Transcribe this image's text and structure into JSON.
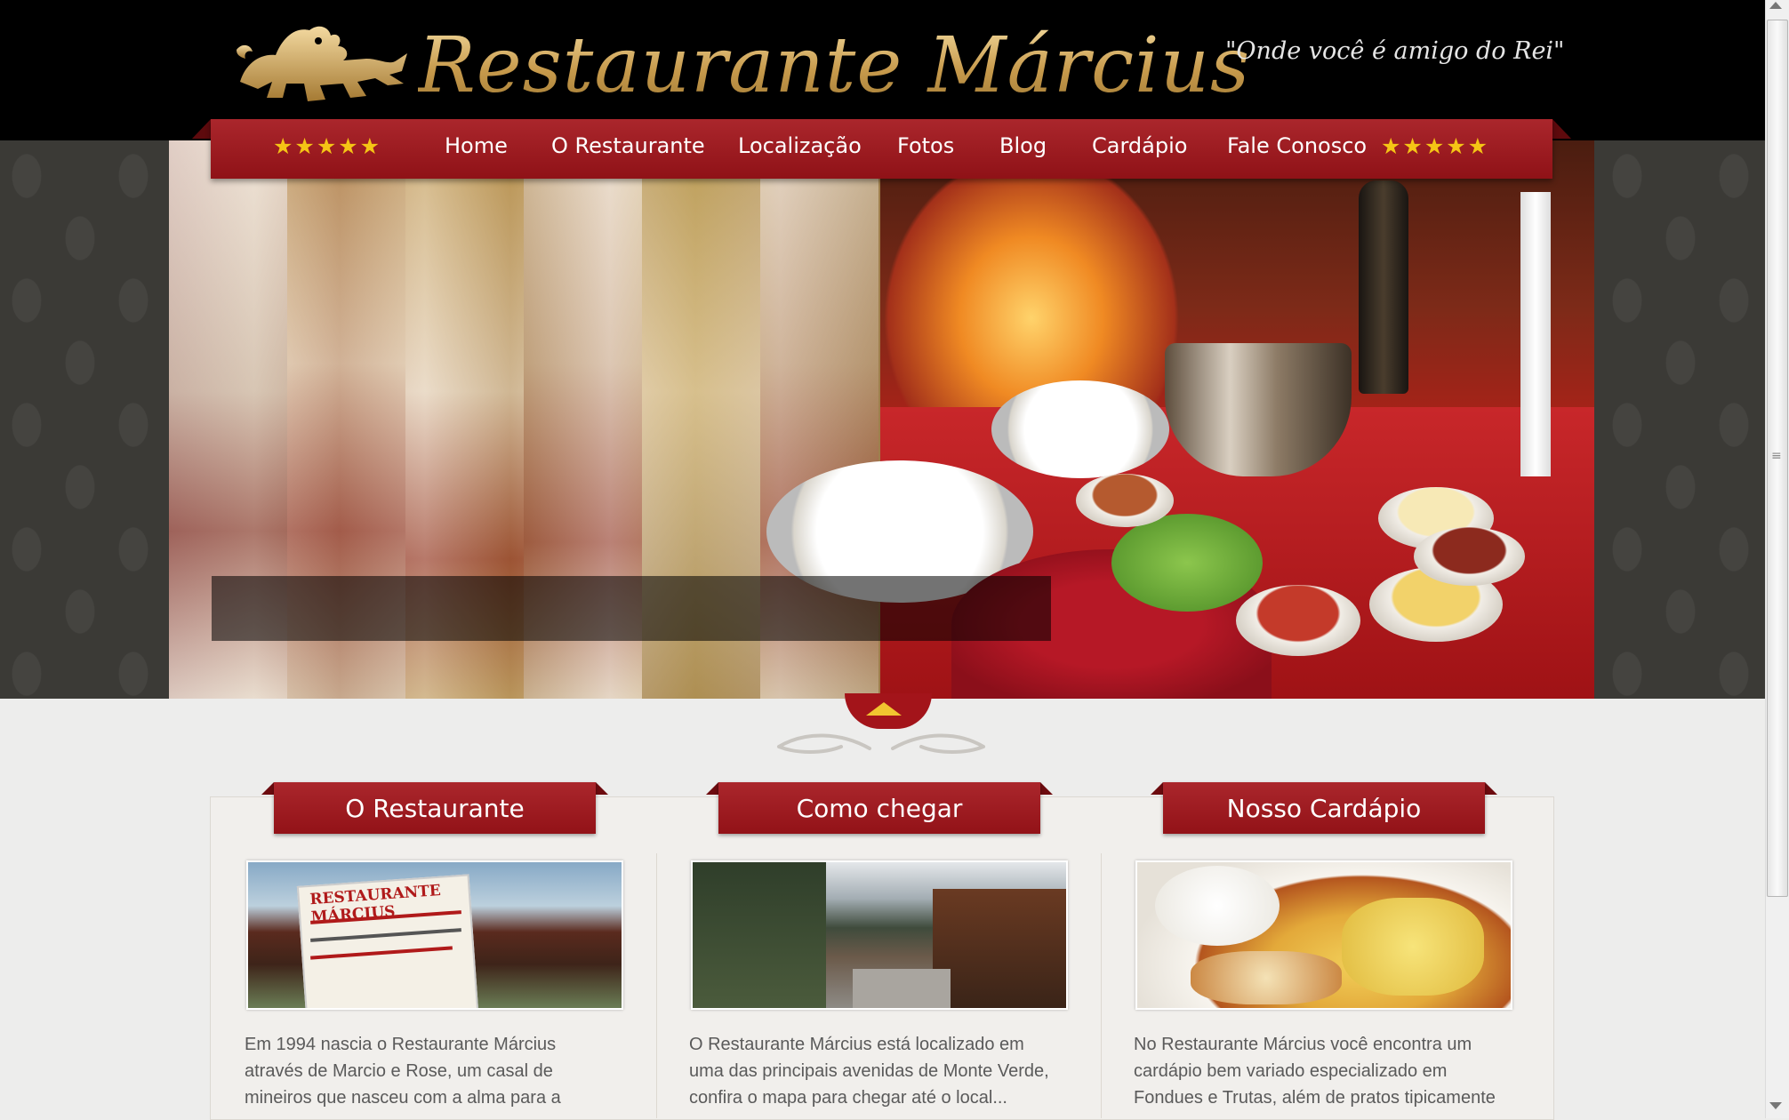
{
  "header": {
    "logo_text": "Restaurante Március",
    "tagline": "\"Onde você é amigo do Rei\"",
    "logo_icon": "heraldic-lion-icon"
  },
  "nav": {
    "stars": "★★★★★",
    "items": [
      {
        "label": "Home"
      },
      {
        "label": "O Restaurante"
      },
      {
        "label": "Localização"
      },
      {
        "label": "Fotos"
      },
      {
        "label": "Blog"
      },
      {
        "label": "Cardápio"
      },
      {
        "label": "Fale Conosco"
      }
    ]
  },
  "columns": [
    {
      "title": "O Restaurante",
      "image": "restaurant-sign-photo",
      "text": "Em 1994 nascia o Restaurante Március através de Marcio e Rose, um casal de mineiros que nasceu com a alma para a"
    },
    {
      "title": "Como chegar",
      "image": "street-photo",
      "text": "O Restaurante Március está localizado em uma das principais avenidas de Monte Verde, confira o mapa para chegar até o local..."
    },
    {
      "title": "Nosso Cardápio",
      "image": "dish-photo",
      "text": "No Restaurante Március você encontra um cardápio bem variado especializado em Fondues e Trutas, além de pratos tipicamente"
    }
  ],
  "colors": {
    "brand_red": "#a3141a",
    "gold": "#d4b06a",
    "star_yellow": "#f5c515"
  }
}
